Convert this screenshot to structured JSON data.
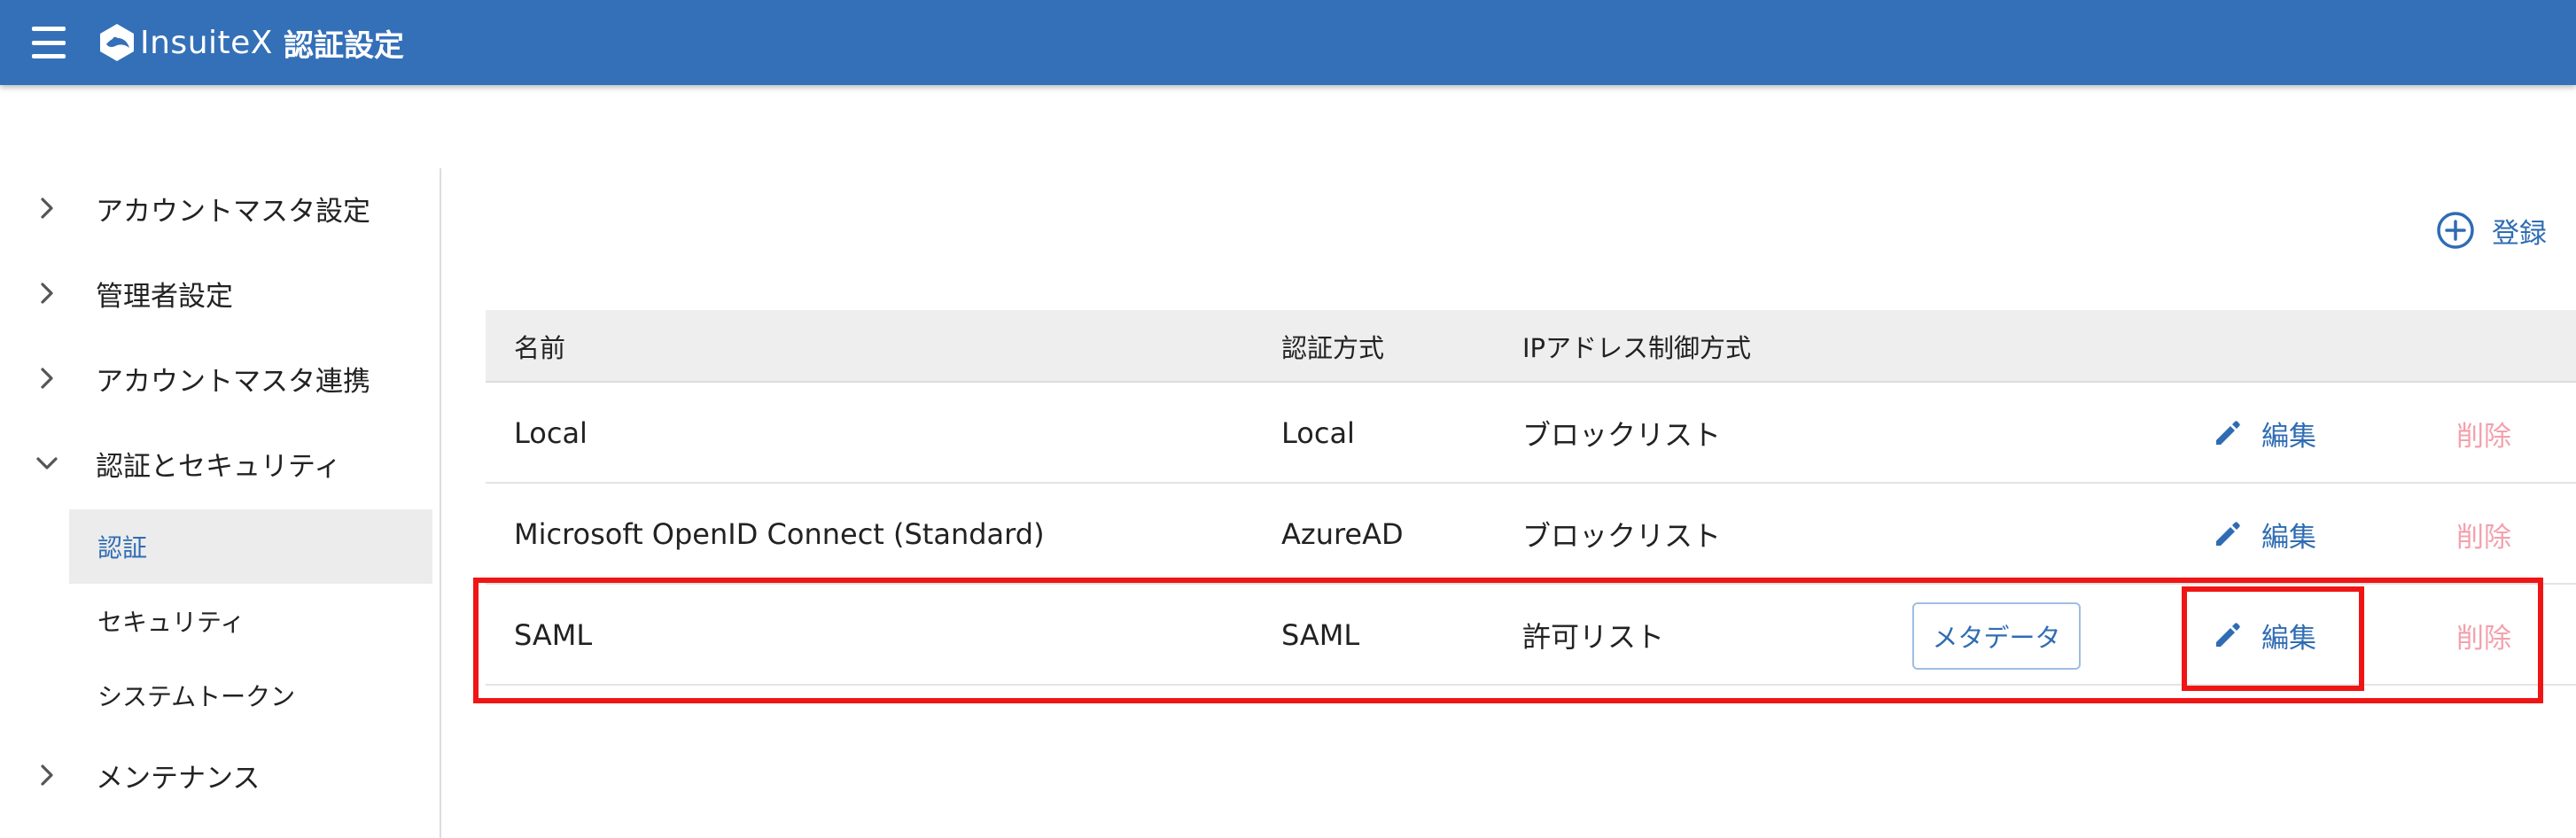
{
  "header": {
    "brand": "InsuiteX",
    "title": "認証設定",
    "bg_color": "#3470b8"
  },
  "sidebar": {
    "items": [
      {
        "label": "アカウントマスタ設定",
        "expanded": false
      },
      {
        "label": "管理者設定",
        "expanded": false
      },
      {
        "label": "アカウントマスタ連携",
        "expanded": false
      },
      {
        "label": "認証とセキュリティ",
        "expanded": true
      },
      {
        "label": "メンテナンス",
        "expanded": false
      }
    ],
    "subitems": [
      {
        "label": "認証",
        "active": true
      },
      {
        "label": "セキュリティ",
        "active": false
      },
      {
        "label": "システムトークン",
        "active": false
      }
    ]
  },
  "toolbar": {
    "register_label": "登録"
  },
  "table": {
    "headers": {
      "name": "名前",
      "auth_method": "認証方式",
      "ip_control": "IPアドレス制御方式"
    },
    "rows": [
      {
        "name": "Local",
        "auth_method": "Local",
        "ip_control": "ブロックリスト",
        "edit": "編集",
        "delete": "削除"
      },
      {
        "name": "Microsoft OpenID Connect (Standard)",
        "auth_method": "AzureAD",
        "ip_control": "ブロックリスト",
        "edit": "編集",
        "delete": "削除"
      },
      {
        "name": "SAML",
        "auth_method": "SAML",
        "ip_control": "許可リスト",
        "metadata": "メタデータ",
        "edit": "編集",
        "delete": "削除"
      }
    ]
  },
  "colors": {
    "accent": "#2f6cb3",
    "delete": "#f3a1ad",
    "highlight": "#f01515"
  }
}
